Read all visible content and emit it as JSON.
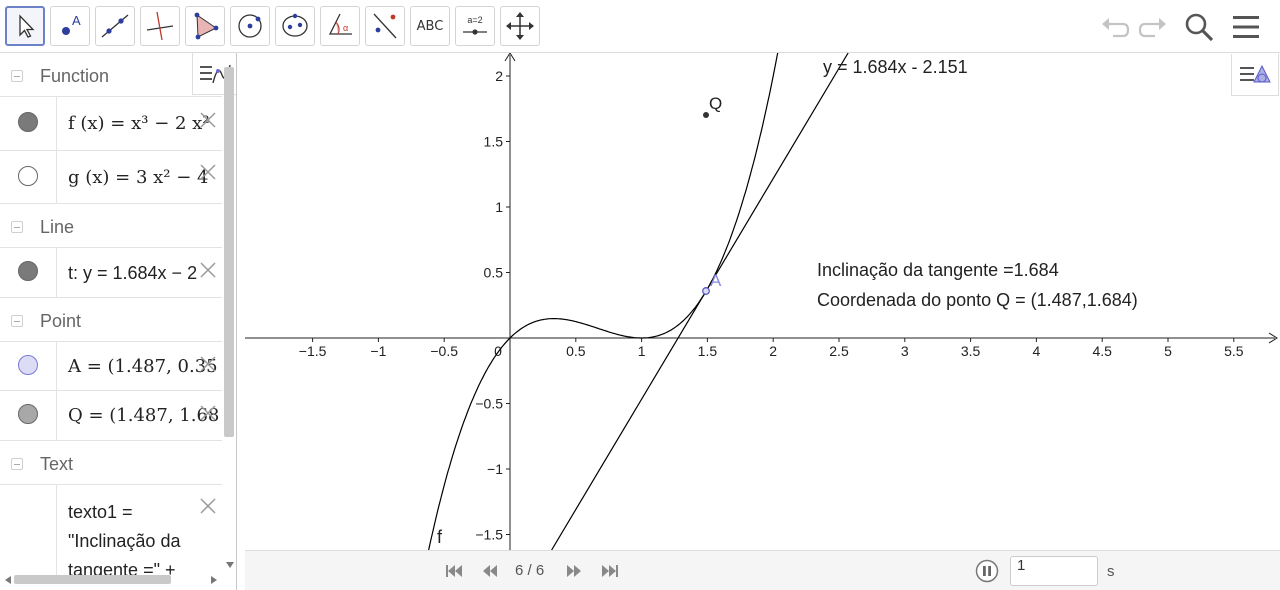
{
  "toolbar": {
    "tools": [
      {
        "name": "move-tool",
        "label": ""
      },
      {
        "name": "point-tool",
        "label": ""
      },
      {
        "name": "line-tool",
        "label": ""
      },
      {
        "name": "perpendicular-line-tool",
        "label": ""
      },
      {
        "name": "polygon-tool",
        "label": ""
      },
      {
        "name": "circle-center-point-tool",
        "label": ""
      },
      {
        "name": "ellipse-tool",
        "label": ""
      },
      {
        "name": "angle-tool",
        "label": ""
      },
      {
        "name": "reflect-tool",
        "label": ""
      },
      {
        "name": "text-tool",
        "label": "ABC"
      },
      {
        "name": "slider-tool",
        "label": "a=2"
      },
      {
        "name": "move-graphics-view-tool",
        "label": ""
      }
    ],
    "right_icons": [
      "undo-icon",
      "redo-icon",
      "search-icon",
      "menu-icon"
    ]
  },
  "algebra": {
    "groups": [
      {
        "label": "Function"
      },
      {
        "label": "Line"
      },
      {
        "label": "Point"
      },
      {
        "label": "Text"
      }
    ],
    "rows": {
      "f": "f (x) = x³ − 2 x²",
      "g": "g (x) = 3 x² − 4",
      "t": "t: y = 1.684x − 2",
      "A": "A = (1.487, 0.35",
      "Q": "Q = (1.487, 1.68",
      "texto1_line1": "texto1 =",
      "texto1_line2": "\"Inclinação da",
      "texto1_line3": "tangente =\" + "
    }
  },
  "graphics": {
    "tangent_label": "y = 1.684x - 2.151",
    "text_line1": "Inclinação da tangente =1.684",
    "text_line2": "Coordenada do ponto Q = (1.487,1.684)",
    "point_Q_label": "Q",
    "point_A_label": "A",
    "curve_label": "f",
    "x_ticks": [
      "−1.5",
      "−1",
      "−0.5",
      "0",
      "0.5",
      "1",
      "1.5",
      "2",
      "2.5",
      "3",
      "3.5",
      "4",
      "4.5",
      "5",
      "5.5"
    ],
    "y_ticks": [
      "2",
      "1.5",
      "1",
      "0.5",
      "−0.5",
      "−1",
      "−1.5"
    ],
    "colors": {
      "axis": "#222222",
      "curve": "#000000",
      "point_A": "#7a7ad8",
      "point_fill": "#333333"
    }
  },
  "player": {
    "counter": "6 / 6",
    "speed_value": "1",
    "speed_unit": "s"
  }
}
